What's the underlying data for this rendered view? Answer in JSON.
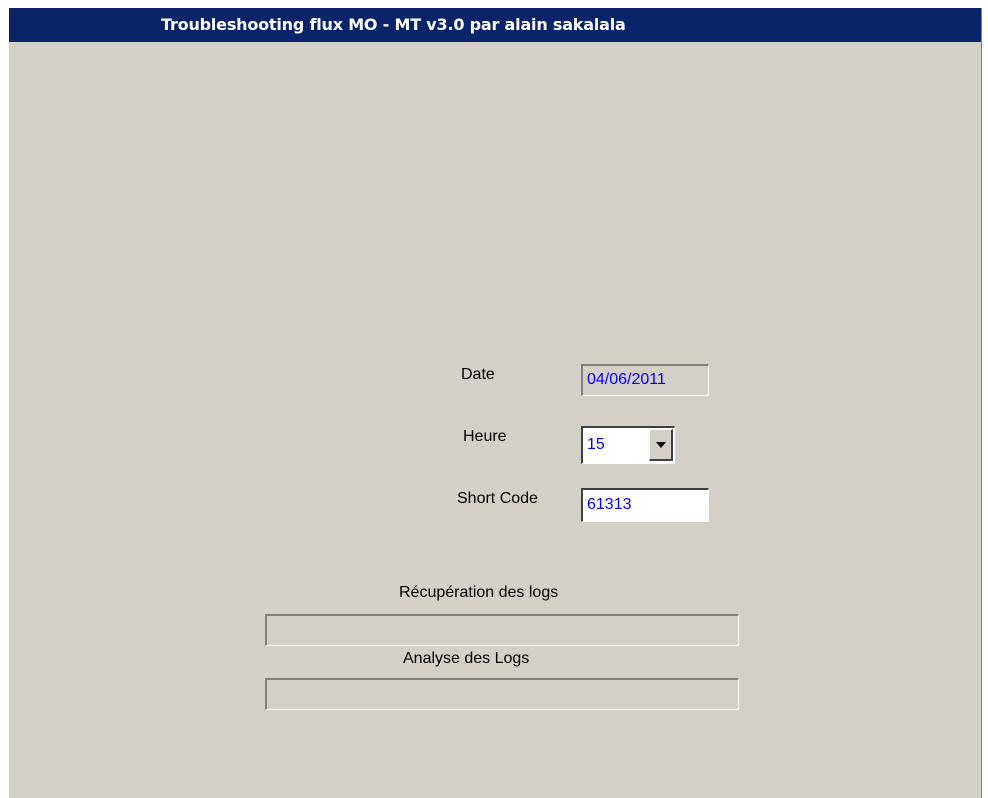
{
  "window": {
    "title": "Troubleshooting flux MO - MT  v3.0 par alain sakalala"
  },
  "form": {
    "date_label": "Date",
    "date_value": "04/06/2011",
    "heure_label": "Heure",
    "heure_value": "15",
    "shortcode_label": "Short Code",
    "shortcode_value": "61313"
  },
  "progress": {
    "recuperation_label": "Récupération des logs",
    "recuperation_value": 0,
    "analyse_label": "Analyse des Logs",
    "analyse_value": 0
  },
  "colors": {
    "title_bar": "#0a246a",
    "window_bg": "#d4d0c8",
    "field_text": "#0000ff"
  },
  "icons": {
    "dropdown": "chevron-down-icon"
  }
}
